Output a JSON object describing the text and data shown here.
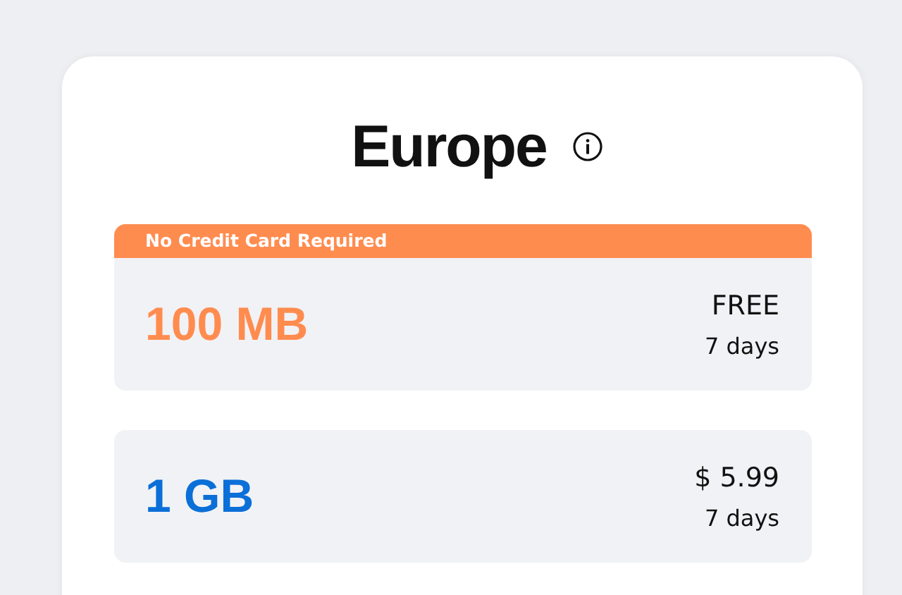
{
  "title": "Europe",
  "plans": [
    {
      "banner": "No Credit Card Required",
      "data": "100 MB",
      "color": "#ff8c4f",
      "price": "FREE",
      "duration": "7 days"
    },
    {
      "data": "1 GB",
      "color": "#0b6fd8",
      "price": "$ 5.99",
      "duration": "7 days"
    }
  ]
}
